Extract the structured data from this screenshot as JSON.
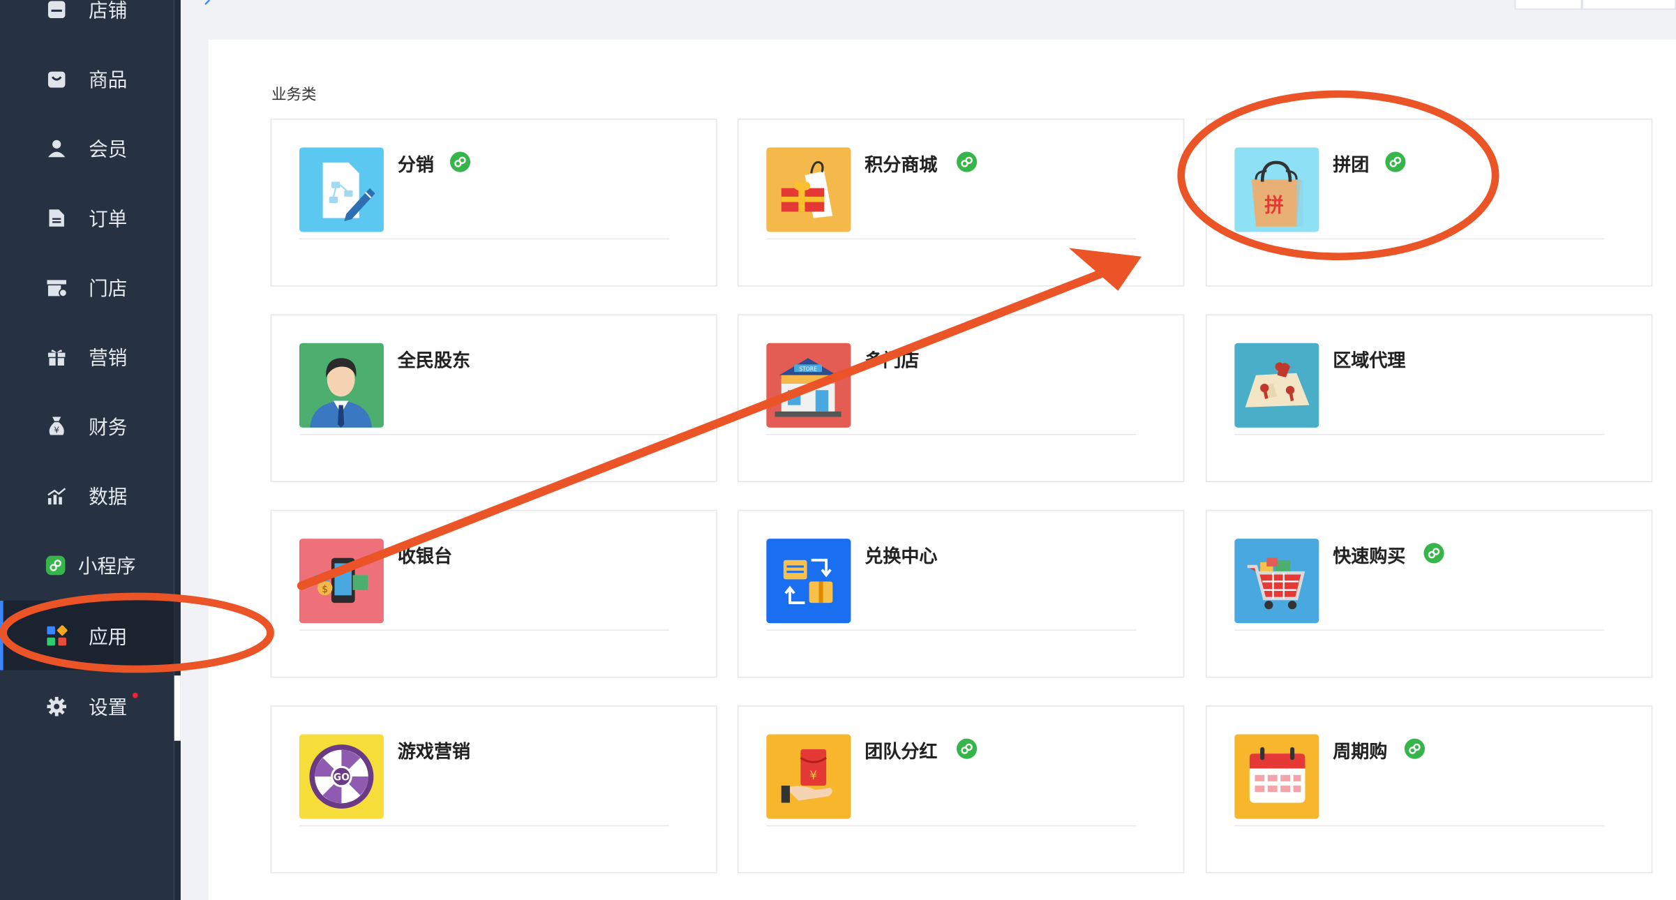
{
  "sidebar": {
    "items": [
      {
        "label": "店铺",
        "icon": "shop-icon"
      },
      {
        "label": "商品",
        "icon": "bag-icon"
      },
      {
        "label": "会员",
        "icon": "user-icon"
      },
      {
        "label": "订单",
        "icon": "document-icon"
      },
      {
        "label": "门店",
        "icon": "store-icon"
      },
      {
        "label": "营销",
        "icon": "gift-icon"
      },
      {
        "label": "财务",
        "icon": "money-bag-icon"
      },
      {
        "label": "数据",
        "icon": "bar-chart-icon"
      },
      {
        "label": "小程序",
        "icon": "miniprogram-icon"
      },
      {
        "label": "应用",
        "icon": "apps-icon",
        "active": true
      },
      {
        "label": "设置",
        "icon": "gear-icon",
        "has_dot": true
      }
    ]
  },
  "main": {
    "section_title": "业务类",
    "apps": [
      {
        "name": "分销",
        "miniprogram": true,
        "icon": "distribution-icon",
        "color": "#5bc8f1"
      },
      {
        "name": "积分商城",
        "miniprogram": true,
        "icon": "points-mall-icon",
        "color": "#f4b94a"
      },
      {
        "name": "拼团",
        "miniprogram": true,
        "icon": "group-buy-icon",
        "color": "#8ee0f5"
      },
      {
        "name": "全民股东",
        "miniprogram": false,
        "icon": "shareholder-icon",
        "color": "#4caf70"
      },
      {
        "name": "多门店",
        "miniprogram": false,
        "icon": "multi-store-icon",
        "color": "#e35d54"
      },
      {
        "name": "区域代理",
        "miniprogram": false,
        "icon": "region-agent-icon",
        "color": "#4aaec9"
      },
      {
        "name": "收银台",
        "miniprogram": false,
        "icon": "cashier-icon",
        "color": "#ee7079"
      },
      {
        "name": "兑换中心",
        "miniprogram": false,
        "icon": "exchange-icon",
        "color": "#1a6ef0"
      },
      {
        "name": "快速购买",
        "miniprogram": true,
        "icon": "quick-buy-icon",
        "color": "#4aa8e0"
      },
      {
        "name": "游戏营销",
        "miniprogram": false,
        "icon": "game-wheel-icon",
        "color": "#f7dd3a"
      },
      {
        "name": "团队分红",
        "miniprogram": true,
        "icon": "team-bonus-icon",
        "color": "#f7b62c"
      },
      {
        "name": "周期购",
        "miniprogram": true,
        "icon": "calendar-icon",
        "color": "#f7b62c"
      }
    ]
  },
  "colors": {
    "annotation": "#ea5427",
    "miniprogram_badge": "#36b54a",
    "sidebar_bg": "#263141"
  }
}
